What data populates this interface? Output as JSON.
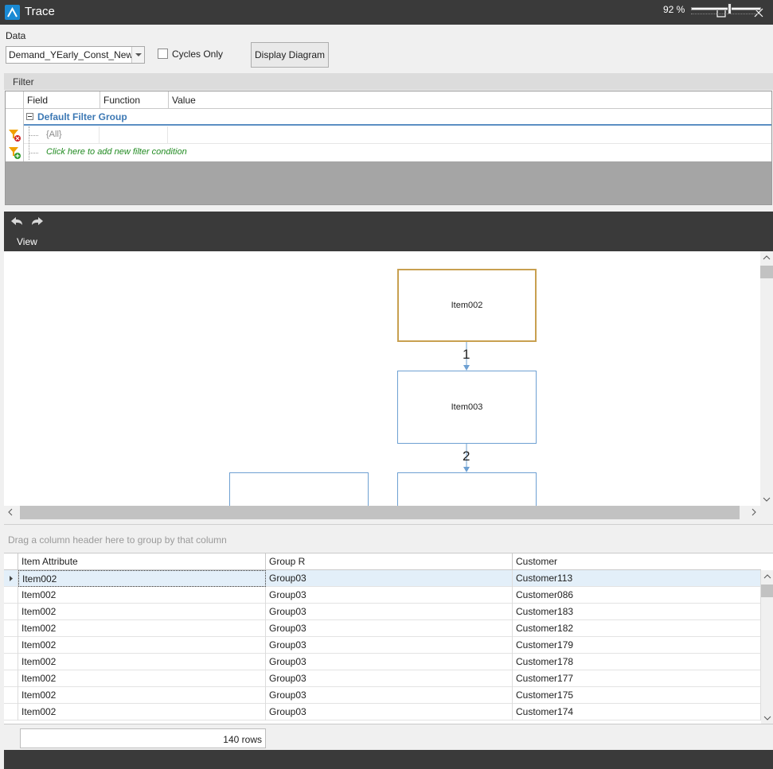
{
  "window": {
    "title": "Trace"
  },
  "data_section": {
    "label": "Data",
    "selected_dataset": "Demand_YEarly_Const_New",
    "cycles_only_label": "Cycles Only",
    "cycles_only_checked": false,
    "display_button_label": "Display Diagram"
  },
  "filter": {
    "title": "Filter",
    "columns": [
      "Field",
      "Function",
      "Value"
    ],
    "group_name": "Default Filter Group",
    "condition": "{All}",
    "add_condition_hint": "Click here to add new filter condition"
  },
  "diagram": {
    "view_tab": "View",
    "nodes": [
      "Item002",
      "Item003"
    ],
    "edge_labels": [
      "1",
      "2"
    ],
    "colors": {
      "selected_border": "#c8a050",
      "node_border": "#6ea0d2",
      "edge": "#6ea0d2"
    }
  },
  "grid": {
    "group_hint": "Drag a column header here to group by that column",
    "columns": [
      "Item Attribute",
      "Group R",
      "Customer"
    ],
    "rows": [
      [
        "Item002",
        "Group03",
        "Customer113"
      ],
      [
        "Item002",
        "Group03",
        "Customer086"
      ],
      [
        "Item002",
        "Group03",
        "Customer183"
      ],
      [
        "Item002",
        "Group03",
        "Customer182"
      ],
      [
        "Item002",
        "Group03",
        "Customer179"
      ],
      [
        "Item002",
        "Group03",
        "Customer178"
      ],
      [
        "Item002",
        "Group03",
        "Customer177"
      ],
      [
        "Item002",
        "Group03",
        "Customer175"
      ],
      [
        "Item002",
        "Group03",
        "Customer174"
      ]
    ],
    "row_count": "140 rows"
  },
  "status": {
    "zoom": "92 %",
    "zoom_fraction": 0.55
  }
}
